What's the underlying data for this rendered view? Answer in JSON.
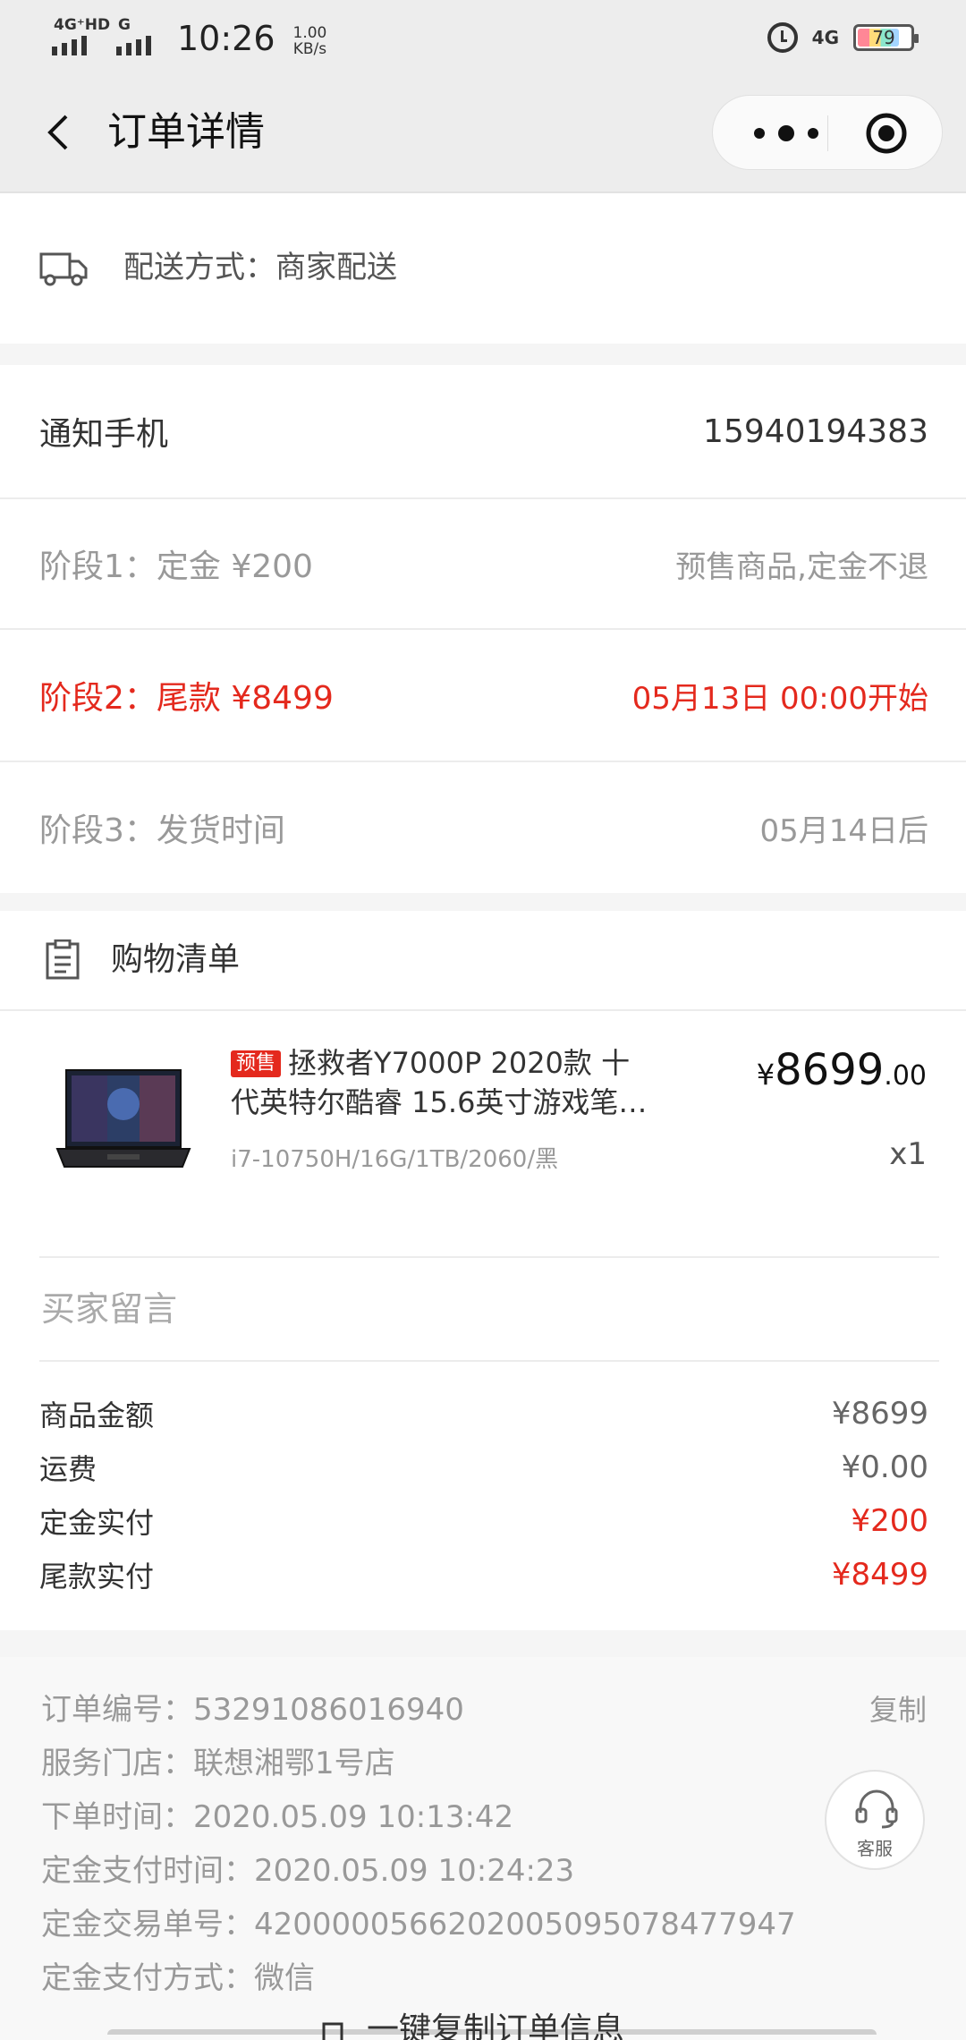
{
  "status_bar": {
    "signal1_label": "4G⁺HD",
    "signal2_label": "G",
    "time": "10:26",
    "speed_value": "1.00",
    "speed_unit": "KB/s",
    "network_right": "4G",
    "battery": "79"
  },
  "nav": {
    "title": "订单详情"
  },
  "delivery": {
    "text": "配送方式：商家配送"
  },
  "phone": {
    "label": "通知手机",
    "value": "15940194383"
  },
  "stages": [
    {
      "left": "阶段1：定金 ¥200",
      "right": "预售商品,定金不退"
    },
    {
      "left": "阶段2：尾款 ¥8499",
      "right": "05月13日 00:00开始"
    },
    {
      "left": "阶段3：发货时间",
      "right": "05月14日后"
    }
  ],
  "shopping_list": {
    "title": "购物清单"
  },
  "product": {
    "badge": "预售",
    "name_line1": "拯救者Y7000P 2020款 十",
    "name_line2": "代英特尔酷睿 15.6英寸游戏笔…",
    "spec": "i7-10750H/16G/1TB/2060/黑",
    "price_symbol": "¥",
    "price_int": "8699",
    "price_dec": ".00",
    "qty": "x1"
  },
  "buyer_message": {
    "label": "买家留言"
  },
  "summary": [
    {
      "label": "商品金额",
      "value": "¥8699"
    },
    {
      "label": "运费",
      "value": "¥0.00"
    },
    {
      "label": "定金实付",
      "value": "¥200"
    },
    {
      "label": "尾款实付",
      "value": "¥8499"
    }
  ],
  "order_info": {
    "order_no": "订单编号：53291086016940",
    "copy_label": "复制",
    "store": "服务门店：联想湘鄂1号店",
    "order_time": "下单时间：2020.05.09 10:13:42",
    "deposit_time": "定金支付时间：2020.05.09 10:24:23",
    "deposit_trade_no": "定金交易单号：4200000566202005095078477947",
    "deposit_method": "定金支付方式：微信",
    "copy_all_label": "一键复制订单信息"
  },
  "service": {
    "label": "客服"
  },
  "colors": {
    "accent_red": "#e4291d",
    "gray_text": "#999999",
    "background": "#f5f5f5"
  }
}
